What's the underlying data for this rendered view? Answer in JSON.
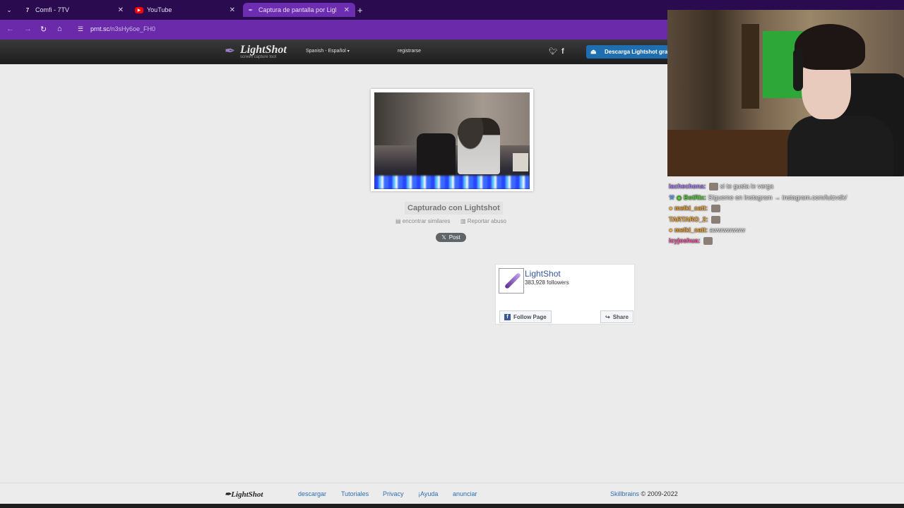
{
  "browser": {
    "tabs": [
      {
        "label": "Comfi - 7TV",
        "icon": "7tv-icon"
      },
      {
        "label": "YouTube",
        "icon": "youtube-icon"
      },
      {
        "label": "Captura de pantalla por Lightsho",
        "icon": "lightshot-feather-icon"
      }
    ],
    "url_host": "prnt.sc",
    "url_path": "/n3sHy6oe_FH0"
  },
  "header": {
    "logo_text": "LightShot",
    "logo_sub": "screen capture tool",
    "language": "Spanish - Español",
    "register": "registrarse",
    "download": "Descarga Lightshot gra"
  },
  "main": {
    "captured": "Capturado con Lightshot",
    "similar": "encontrar similares",
    "abuse": "Reportar abuso",
    "post": "Post"
  },
  "fb_widget": {
    "name": "LightShot",
    "followers": "383,928 followers",
    "follow": "Follow Page",
    "share": "Share"
  },
  "footer": {
    "logo": "LightShot",
    "links": [
      "descargar",
      "Tutoriales",
      "Privacy",
      "¡Ayuda",
      "anunciar"
    ],
    "company": "Skillbrains",
    "copyright": "© 2009-2022"
  },
  "chat": [
    {
      "user": "lachechona:",
      "user_color": "#b084ff",
      "text": "si te gusta le verga"
    },
    {
      "user": "BotRix:",
      "user_color": "#5bd03c",
      "text": "Sígueme en Instagram → instagram.com/luizvdk/"
    },
    {
      "user": "melki_catt:",
      "user_color": "#f2a93b",
      "text": ""
    },
    {
      "user": "TARTARO_2:",
      "user_color": "#f2a93b",
      "text": ""
    },
    {
      "user": "melki_catt:",
      "user_color": "#f2a93b",
      "text": "awwwwwww"
    },
    {
      "user": "icyjoshua:",
      "user_color": "#ff5aa8",
      "text": ""
    }
  ],
  "colors": {
    "tab_bar": "#2a0b4f",
    "address_bar": "#6a2aaa",
    "download_button": "#1f6fb0",
    "link": "#2c6db3"
  }
}
